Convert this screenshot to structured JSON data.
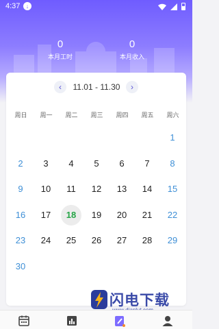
{
  "status_bar": {
    "time": "4:37"
  },
  "summary": {
    "hours_value": "0",
    "hours_label": "本月工时",
    "income_value": "0",
    "income_label": "本月收入"
  },
  "calendar": {
    "range": "11.01 - 11.30",
    "weekdays": [
      "周日",
      "周一",
      "周二",
      "周三",
      "周四",
      "周五",
      "周六"
    ],
    "weeks": [
      [
        "",
        "",
        "",
        "",
        "",
        "",
        "1"
      ],
      [
        "2",
        "3",
        "4",
        "5",
        "6",
        "7",
        "8"
      ],
      [
        "9",
        "10",
        "11",
        "12",
        "13",
        "14",
        "15"
      ],
      [
        "16",
        "17",
        "18",
        "19",
        "20",
        "21",
        "22"
      ],
      [
        "23",
        "24",
        "25",
        "26",
        "27",
        "28",
        "29"
      ],
      [
        "30",
        "",
        "",
        "",
        "",
        "",
        ""
      ]
    ],
    "today": "18"
  },
  "tabbar": {
    "tabs": [
      "calendar-icon",
      "chart-icon",
      "edit-icon",
      "profile-icon"
    ],
    "active_index": 2
  },
  "watermark": {
    "title": "闪电下载",
    "url": "www.dianlut.com"
  },
  "colors": {
    "accent": "#6f5cff",
    "weekend": "#3e8fd6",
    "today": "#26a547"
  }
}
